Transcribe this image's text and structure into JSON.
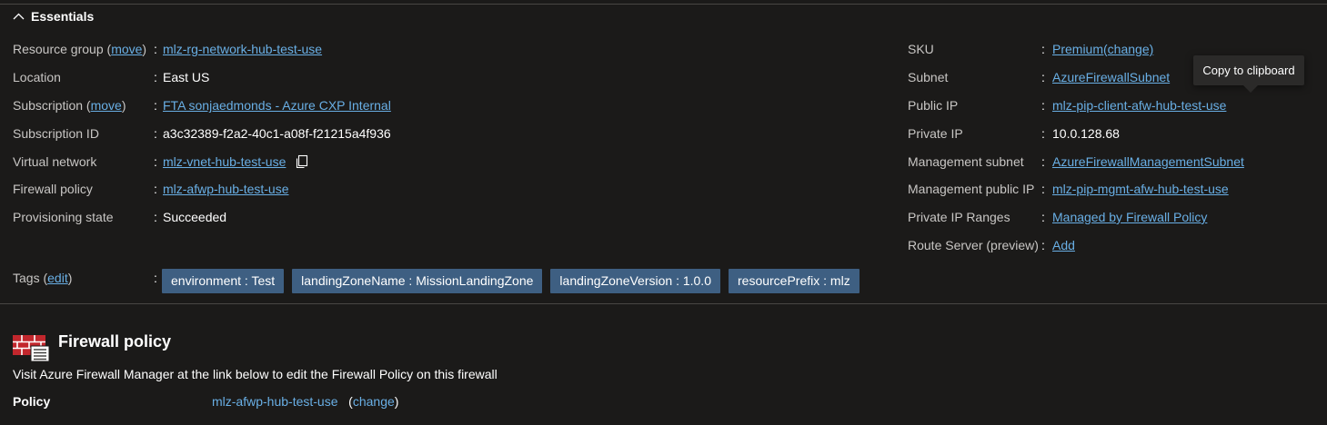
{
  "essentials": {
    "title": "Essentials",
    "left": [
      {
        "label": "Resource group",
        "label_link": "move",
        "value": "mlz-rg-network-hub-test-use",
        "value_is_link": true
      },
      {
        "label": "Location",
        "label_link": "",
        "value": "East US",
        "value_is_link": false
      },
      {
        "label": "Subscription",
        "label_link": "move",
        "value": "FTA sonjaedmonds - Azure CXP Internal",
        "value_is_link": true
      },
      {
        "label": "Subscription ID",
        "label_link": "",
        "value": "a3c32389-f2a2-40c1-a08f-f21215a4f936",
        "value_is_link": false
      },
      {
        "label": "Virtual network",
        "label_link": "",
        "value": "mlz-vnet-hub-test-use",
        "value_is_link": true
      },
      {
        "label": "Firewall policy",
        "label_link": "",
        "value": "mlz-afwp-hub-test-use",
        "value_is_link": true
      },
      {
        "label": "Provisioning state",
        "label_link": "",
        "value": "Succeeded",
        "value_is_link": false
      }
    ],
    "right": [
      {
        "label": "SKU",
        "value": "Premium(change)",
        "value_is_link": true
      },
      {
        "label": "Subnet",
        "value": "AzureFirewallSubnet",
        "value_is_link": true
      },
      {
        "label": "Public IP",
        "value": "mlz-pip-client-afw-hub-test-use",
        "value_is_link": true
      },
      {
        "label": "Private IP",
        "value": "10.0.128.68",
        "value_is_link": false
      },
      {
        "label": "Management subnet",
        "value": "AzureFirewallManagementSubnet",
        "value_is_link": true
      },
      {
        "label": "Management public IP",
        "value": "mlz-pip-mgmt-afw-hub-test-use",
        "value_is_link": true
      },
      {
        "label": "Private IP Ranges",
        "value": "Managed by Firewall Policy",
        "value_is_link": true
      },
      {
        "label": "Route Server (preview)",
        "value": "Add",
        "value_is_link": true
      }
    ],
    "tags_label": "Tags",
    "tags_link": "edit",
    "tags": [
      "environment : Test",
      "landingZoneName : MissionLandingZone",
      "landingZoneVersion : 1.0.0",
      "resourcePrefix : mlz"
    ]
  },
  "tooltip": "Copy to clipboard",
  "firewall_policy": {
    "title": "Firewall policy",
    "description": "Visit Azure Firewall Manager at the link below to edit the Firewall Policy on this firewall",
    "policy_label": "Policy",
    "policy_value": "mlz-afwp-hub-test-use",
    "change_label": "change"
  },
  "icons": {
    "collapse": "chevron-up-icon",
    "copy": "copy-icon",
    "firewall": "firewall-icon"
  },
  "colors": {
    "background": "#1b1a19",
    "link": "#69afe5",
    "tag_bg": "#3e5f82",
    "label": "#c8c6c4"
  }
}
